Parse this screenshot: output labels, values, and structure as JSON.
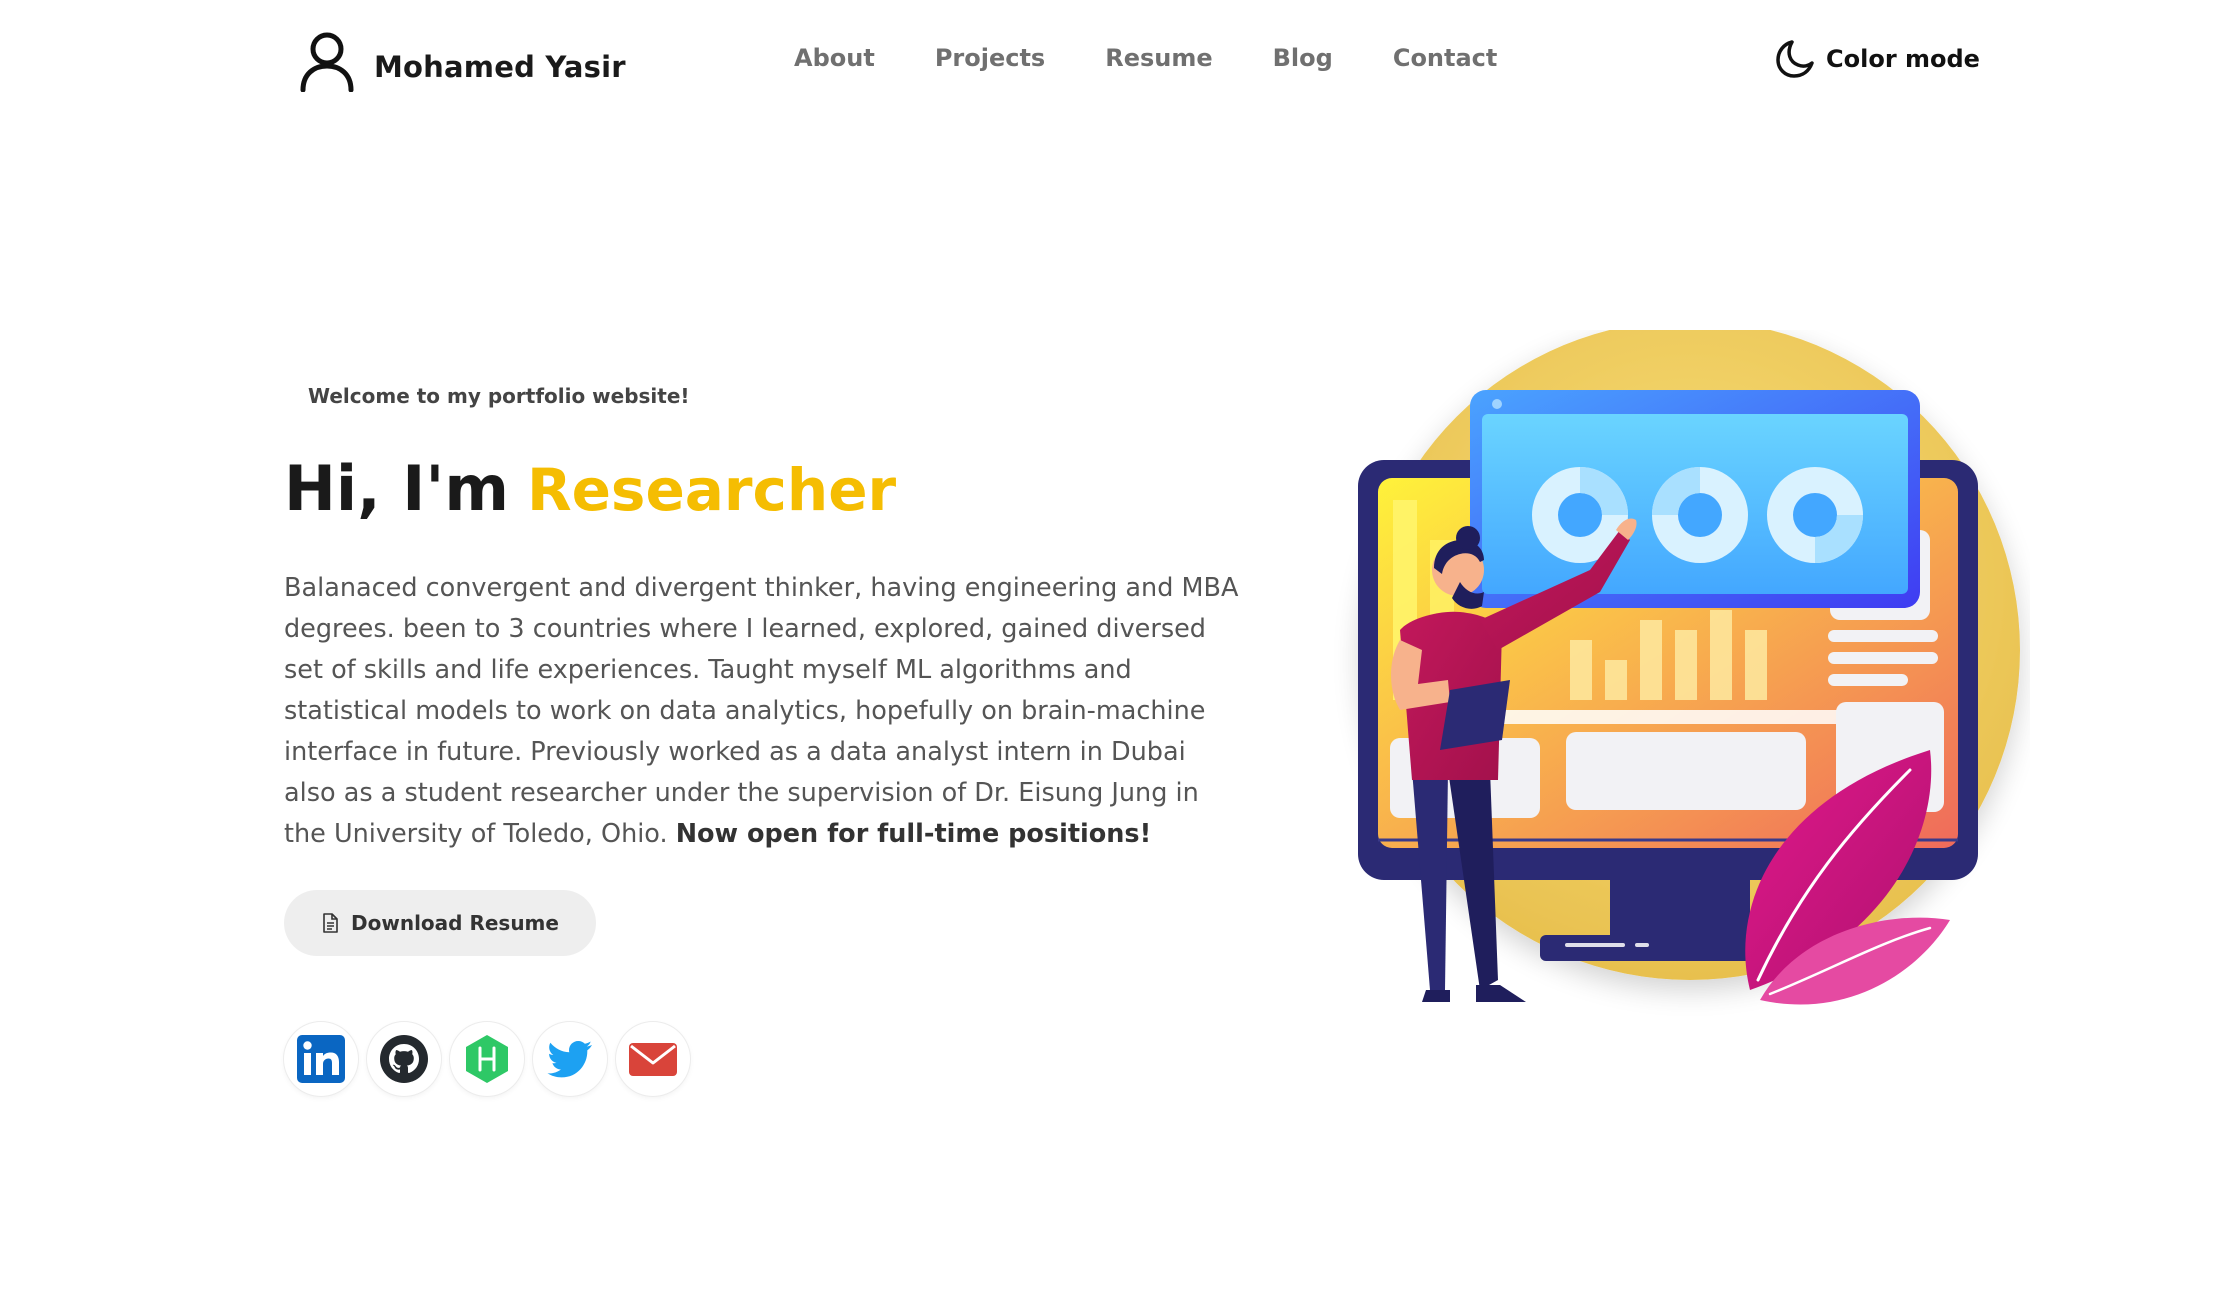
{
  "brand": {
    "name": "Mohamed Yasir",
    "icon": "user-icon"
  },
  "nav": {
    "links": [
      "About",
      "Projects",
      "Resume",
      "Blog",
      "Contact"
    ]
  },
  "color_mode": {
    "label": "Color mode",
    "icon": "moon-icon"
  },
  "hero": {
    "welcome": "Welcome to my portfolio website!",
    "greeting": "Hi, I'm",
    "role": "Researcher",
    "bio": "Balanaced convergent and divergent thinker, having engineering and MBA degrees. been to 3 countries where I learned, explored, gained diversed set of skills and life experiences. Taught myself ML algorithms and statistical models to work on data analytics, hopefully on brain-machine interface in future. Previously worked as a data analyst intern in Dubai also as a student researcher under the supervision of Dr. Eisung Jung in the University of Toledo, Ohio.",
    "bio_highlight": "Now open for full-time positions!",
    "download_label": "Download Resume"
  },
  "socials": [
    {
      "name": "linkedin-icon",
      "color": "#0a66c2"
    },
    {
      "name": "github-icon",
      "color": "#24292e"
    },
    {
      "name": "hackerrank-icon",
      "color": "#2ec866"
    },
    {
      "name": "twitter-icon",
      "color": "#1da1f2"
    },
    {
      "name": "email-icon",
      "color": "#d9443a"
    }
  ],
  "colors": {
    "accent": "#f5bd02",
    "text": "#1a1a1a",
    "muted": "#707070",
    "button_bg": "#eeeeee"
  }
}
